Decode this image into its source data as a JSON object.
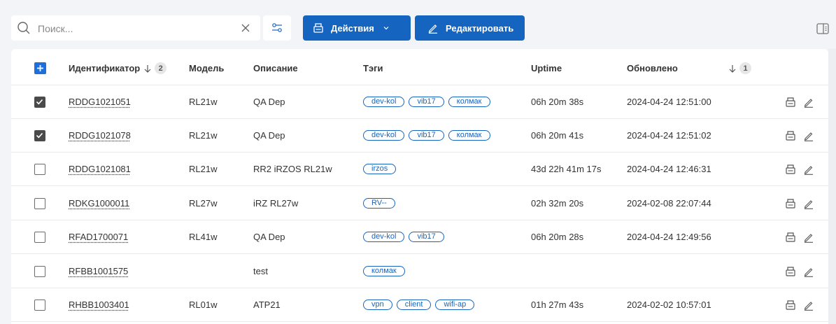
{
  "toolbar": {
    "search_placeholder": "Поиск...",
    "search_value": "",
    "actions_label": "Действия",
    "edit_label": "Редактировать"
  },
  "table": {
    "columns": {
      "id": "Идентификатор",
      "id_sort_badge": "2",
      "model": "Модель",
      "description": "Описание",
      "tags": "Тэги",
      "uptime": "Uptime",
      "updated": "Обновлено",
      "extra_sort_badge": "1"
    },
    "rows": [
      {
        "checked": true,
        "id": "RDDG1021051",
        "model": "RL21w",
        "description": "QA Dep",
        "tags": [
          "dev-kol",
          "vib17",
          "колмак"
        ],
        "uptime": "06h 20m 38s",
        "updated": "2024-04-24 12:51:00"
      },
      {
        "checked": true,
        "id": "RDDG1021078",
        "model": "RL21w",
        "description": "QA Dep",
        "tags": [
          "dev-kol",
          "vib17",
          "колмак"
        ],
        "uptime": "06h 20m 41s",
        "updated": "2024-04-24 12:51:02"
      },
      {
        "checked": false,
        "id": "RDDG1021081",
        "model": "RL21w",
        "description": "RR2 iRZOS RL21w",
        "tags": [
          "irzos"
        ],
        "uptime": "43d 22h 41m 17s",
        "updated": "2024-04-24 12:46:31"
      },
      {
        "checked": false,
        "id": "RDKG1000011",
        "model": "RL27w",
        "description": "iRZ RL27w",
        "tags": [
          "RV--"
        ],
        "uptime": "02h 32m 20s",
        "updated": "2024-02-08 22:07:44"
      },
      {
        "checked": false,
        "id": "RFAD1700071",
        "model": "RL41w",
        "description": "QA Dep",
        "tags": [
          "dev-kol",
          "vib17"
        ],
        "uptime": "06h 20m 28s",
        "updated": "2024-04-24 12:49:56"
      },
      {
        "checked": false,
        "id": "RFBB1001575",
        "model": "",
        "description": "test",
        "tags": [
          "колмак"
        ],
        "uptime": "",
        "updated": ""
      },
      {
        "checked": false,
        "id": "RHBB1003401",
        "model": "RL01w",
        "description": "ATP21",
        "tags": [
          "vpn",
          "client",
          "wifi-ap"
        ],
        "uptime": "01h 27m 43s",
        "updated": "2024-02-02 10:57:01"
      }
    ]
  },
  "colors": {
    "primary": "#1565c0",
    "header_checkbox": "#1e6fdc",
    "checked_box": "#4a4a4a",
    "background": "#f3f4f7"
  },
  "icons": {
    "search": "search-icon",
    "clear": "close-icon",
    "filter": "filter-settings-icon",
    "actions": "printer-icon",
    "edit": "pencil-icon",
    "columns": "columns-panel-icon",
    "sort": "arrow-down-icon"
  }
}
